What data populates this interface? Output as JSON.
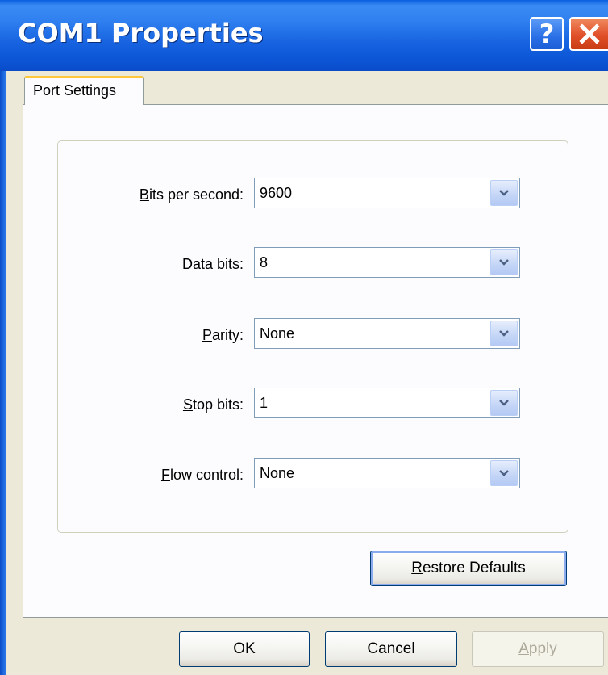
{
  "window": {
    "title": "COM1 Properties",
    "help_label": "?",
    "icons": {
      "help": "help-icon",
      "close": "close-icon"
    },
    "colors": {
      "titlebar": "#2f7ff0",
      "close": "#e0502a",
      "tab_highlight": "#ffc83c"
    }
  },
  "tabs": [
    {
      "label": "Port Settings",
      "selected": true
    }
  ],
  "fields": {
    "bits_per_second": {
      "mnemonic": "B",
      "label_rest": "its per second:",
      "value": "9600"
    },
    "data_bits": {
      "mnemonic": "D",
      "label_rest": "ata bits:",
      "value": "8"
    },
    "parity": {
      "mnemonic": "P",
      "label_rest": "arity:",
      "value": "None"
    },
    "stop_bits": {
      "mnemonic": "S",
      "label_rest": "top bits:",
      "value": "1"
    },
    "flow_control": {
      "mnemonic": "F",
      "label_rest": "low control:",
      "value": "None"
    }
  },
  "buttons": {
    "restore_defaults": {
      "mnemonic": "R",
      "label_rest": "estore Defaults"
    },
    "ok": "OK",
    "cancel": "Cancel",
    "apply": {
      "mnemonic": "A",
      "label_rest": "pply",
      "enabled": false
    }
  }
}
